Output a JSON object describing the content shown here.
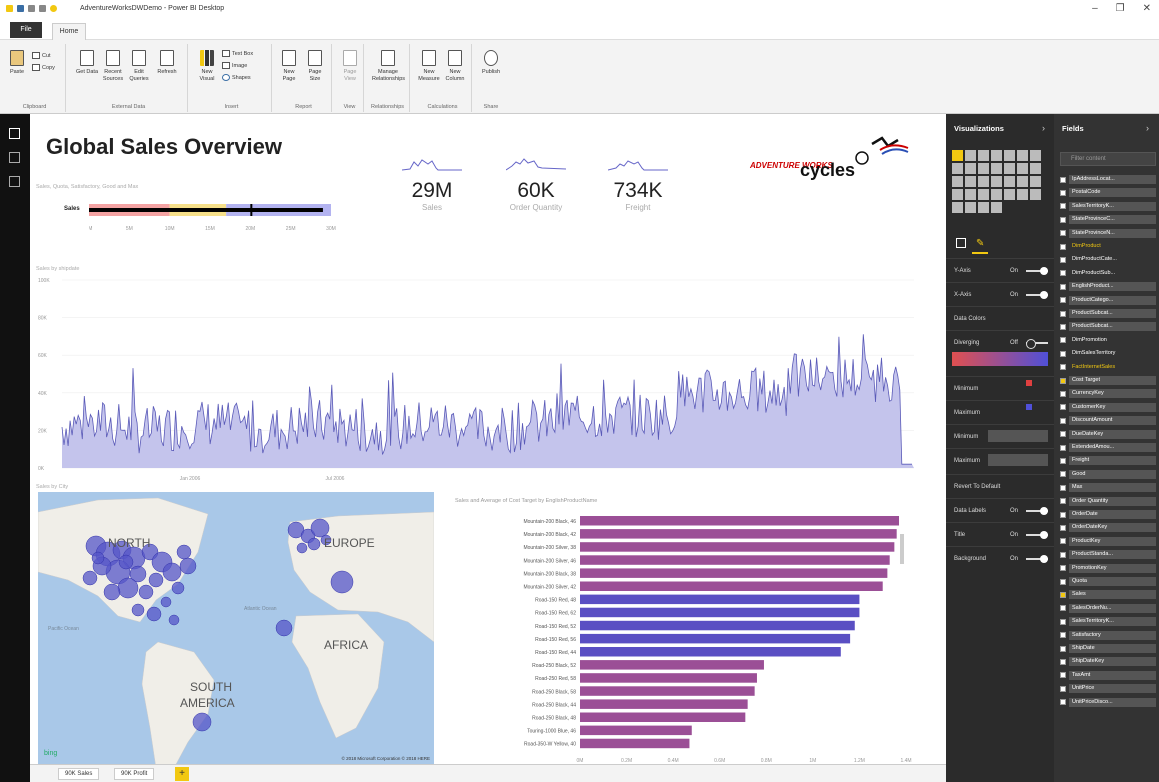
{
  "window": {
    "title": "AdventureWorksDWDemo - Power BI Desktop",
    "controls": [
      "–",
      "❐",
      "✕"
    ]
  },
  "menu": {
    "file": "File",
    "home": "Home"
  },
  "ribbon": {
    "groups": [
      {
        "label": "Clipboard",
        "buttons": [
          "Paste"
        ],
        "small": [
          "Cut",
          "Copy"
        ]
      },
      {
        "label": "External Data",
        "buttons": [
          "Get Data",
          "Recent Sources",
          "Edit Queries",
          "Refresh"
        ]
      },
      {
        "label": "Insert",
        "buttons": [
          "New Visual"
        ],
        "small": [
          "Text Box",
          "Image",
          "Shapes"
        ]
      },
      {
        "label": "Report",
        "buttons": [
          "New Page",
          "Page Size"
        ]
      },
      {
        "label": "View",
        "buttons": [
          "Page View"
        ]
      },
      {
        "label": "Relationships",
        "buttons": [
          "Manage Relationships"
        ]
      },
      {
        "label": "Calculations",
        "buttons": [
          "New Measure",
          "New Column"
        ]
      },
      {
        "label": "Share",
        "buttons": [
          "Publish"
        ]
      }
    ]
  },
  "report": {
    "title": "Global Sales Overview",
    "kpis": [
      {
        "value": "29M",
        "label": "Sales"
      },
      {
        "value": "60K",
        "label": "Order Quantity"
      },
      {
        "value": "734K",
        "label": "Freight"
      }
    ],
    "bullet": {
      "title": "Sales, Quota, Satisfactory, Good and Max",
      "category": "Sales",
      "ticks": [
        "0M",
        "5M",
        "10M",
        "15M",
        "20M",
        "25M",
        "30M"
      ],
      "colors": {
        "poor": "#f4a3a3",
        "satisfactory": "#f6e08a",
        "good": "#b3b3f0",
        "bar": "#000000"
      }
    },
    "line": {
      "title": "Sales by shipdate",
      "yticks": [
        "100K",
        "80K",
        "60K",
        "40K",
        "20K",
        "0K"
      ],
      "xticks": [
        "Jan 2006",
        "Jul 2006"
      ],
      "color": "#5a5ab8"
    },
    "map": {
      "title": "Sales by City",
      "labels": [
        "NORTH",
        "EUROPE",
        "AFRICA",
        "SOUTH",
        "AMERICA",
        "Atlantic Ocean",
        "Pacific Ocean"
      ],
      "bing": "bing",
      "copyright": "© 2018 Microsoft Corporation  © 2018 HERE",
      "bubble_color": "#5555c8"
    },
    "bar": {
      "title": "Sales and Average of Cost Target by EnglishProductName",
      "xticks": [
        "0M",
        "0.2M",
        "0.4M",
        "0.6M",
        "0.8M",
        "1M",
        "1.2M",
        "1.4M"
      ]
    },
    "logo": {
      "line1": "ADVENTURE WORKS",
      "line2": "cycles"
    }
  },
  "chart_data": {
    "type": "bar",
    "title": "Sales and Average of Cost Target by EnglishProductName",
    "categories": [
      "Mountain-200 Black, 46",
      "Mountain-200 Black, 42",
      "Mountain-200 Silver, 38",
      "Mountain-200 Silver, 46",
      "Mountain-200 Black, 38",
      "Mountain-200 Silver, 42",
      "Road-150 Red, 48",
      "Road-150 Red, 62",
      "Road-150 Red, 52",
      "Road-150 Red, 56",
      "Road-150 Red, 44",
      "Road-250 Black, 52",
      "Road-250 Red, 58",
      "Road-250 Black, 58",
      "Road-250 Black, 44",
      "Road-250 Black, 48",
      "Touring-1000 Blue, 46",
      "Road-350-W Yellow, 40"
    ],
    "values": [
      1.37,
      1.36,
      1.35,
      1.33,
      1.32,
      1.3,
      1.2,
      1.2,
      1.18,
      1.16,
      1.12,
      0.79,
      0.76,
      0.75,
      0.72,
      0.71,
      0.48,
      0.47
    ],
    "colors": [
      "#9b4f96",
      "#9b4f96",
      "#9b4f96",
      "#9b4f96",
      "#9b4f96",
      "#9b4f96",
      "#5a4fc3",
      "#5a4fc3",
      "#5a4fc3",
      "#5a4fc3",
      "#5a4fc3",
      "#9b4f96",
      "#9b4f96",
      "#9b4f96",
      "#9b4f96",
      "#9b4f96",
      "#9b4f96",
      "#9b4f96"
    ],
    "xlim": [
      0,
      1.4
    ]
  },
  "pagetabs": [
    "90K Sales",
    "90K Profit"
  ],
  "visualizations": {
    "header": "Visualizations",
    "format_rows": [
      {
        "label": "Y-Axis",
        "state": "On"
      },
      {
        "label": "X-Axis",
        "state": "On"
      },
      {
        "label": "Data Colors",
        "state": ""
      },
      {
        "label": "Diverging",
        "state": "Off"
      },
      {
        "label": "Minimum",
        "state": ""
      },
      {
        "label": "Maximum",
        "state": ""
      },
      {
        "label": "Minimum",
        "state": ""
      },
      {
        "label": "Maximum",
        "state": ""
      },
      {
        "label": "Revert To Default",
        "state": ""
      },
      {
        "label": "Data Labels",
        "state": "On"
      },
      {
        "label": "Title",
        "state": "On"
      },
      {
        "label": "Background",
        "state": "On"
      }
    ]
  },
  "fields": {
    "header": "Fields",
    "search_placeholder": "Filter content",
    "items": [
      {
        "name": "IpAddressLocat...",
        "kind": "field"
      },
      {
        "name": "PostalCode",
        "kind": "field"
      },
      {
        "name": "SalesTerritoryK...",
        "kind": "field"
      },
      {
        "name": "StateProvinceC...",
        "kind": "field"
      },
      {
        "name": "StateProvinceN...",
        "kind": "field"
      },
      {
        "name": "DimProduct",
        "kind": "table",
        "hl": true
      },
      {
        "name": "DimProductCate...",
        "kind": "table"
      },
      {
        "name": "DimProductSub...",
        "kind": "table"
      },
      {
        "name": "EnglishProduct...",
        "kind": "field"
      },
      {
        "name": "ProductCatego...",
        "kind": "field"
      },
      {
        "name": "ProductSubcat...",
        "kind": "field"
      },
      {
        "name": "ProductSubcat...",
        "kind": "field"
      },
      {
        "name": "DimPromotion",
        "kind": "table"
      },
      {
        "name": "DimSalesTerritory",
        "kind": "table"
      },
      {
        "name": "FactInternetSales",
        "kind": "table",
        "hl": true
      },
      {
        "name": "Cost Target",
        "kind": "field",
        "checked": true
      },
      {
        "name": "CurrencyKey",
        "kind": "field"
      },
      {
        "name": "CustomerKey",
        "kind": "field"
      },
      {
        "name": "DiscountAmount",
        "kind": "field"
      },
      {
        "name": "DueDateKey",
        "kind": "field"
      },
      {
        "name": "ExtendedAmou...",
        "kind": "field"
      },
      {
        "name": "Freight",
        "kind": "field"
      },
      {
        "name": "Good",
        "kind": "field"
      },
      {
        "name": "Max",
        "kind": "field"
      },
      {
        "name": "Order Quantity",
        "kind": "field"
      },
      {
        "name": "OrderDate",
        "kind": "field"
      },
      {
        "name": "OrderDateKey",
        "kind": "field"
      },
      {
        "name": "ProductKey",
        "kind": "field"
      },
      {
        "name": "ProductStanda...",
        "kind": "field"
      },
      {
        "name": "PromotionKey",
        "kind": "field"
      },
      {
        "name": "Quota",
        "kind": "field"
      },
      {
        "name": "Sales",
        "kind": "field",
        "checked": true
      },
      {
        "name": "SalesOrderNu...",
        "kind": "field"
      },
      {
        "name": "SalesTerritoryK...",
        "kind": "field"
      },
      {
        "name": "Satisfactory",
        "kind": "field"
      },
      {
        "name": "ShipDate",
        "kind": "field"
      },
      {
        "name": "ShipDateKey",
        "kind": "field"
      },
      {
        "name": "TaxAmt",
        "kind": "field"
      },
      {
        "name": "UnitPrice",
        "kind": "field"
      },
      {
        "name": "UnitPriceDisco...",
        "kind": "field"
      }
    ]
  }
}
